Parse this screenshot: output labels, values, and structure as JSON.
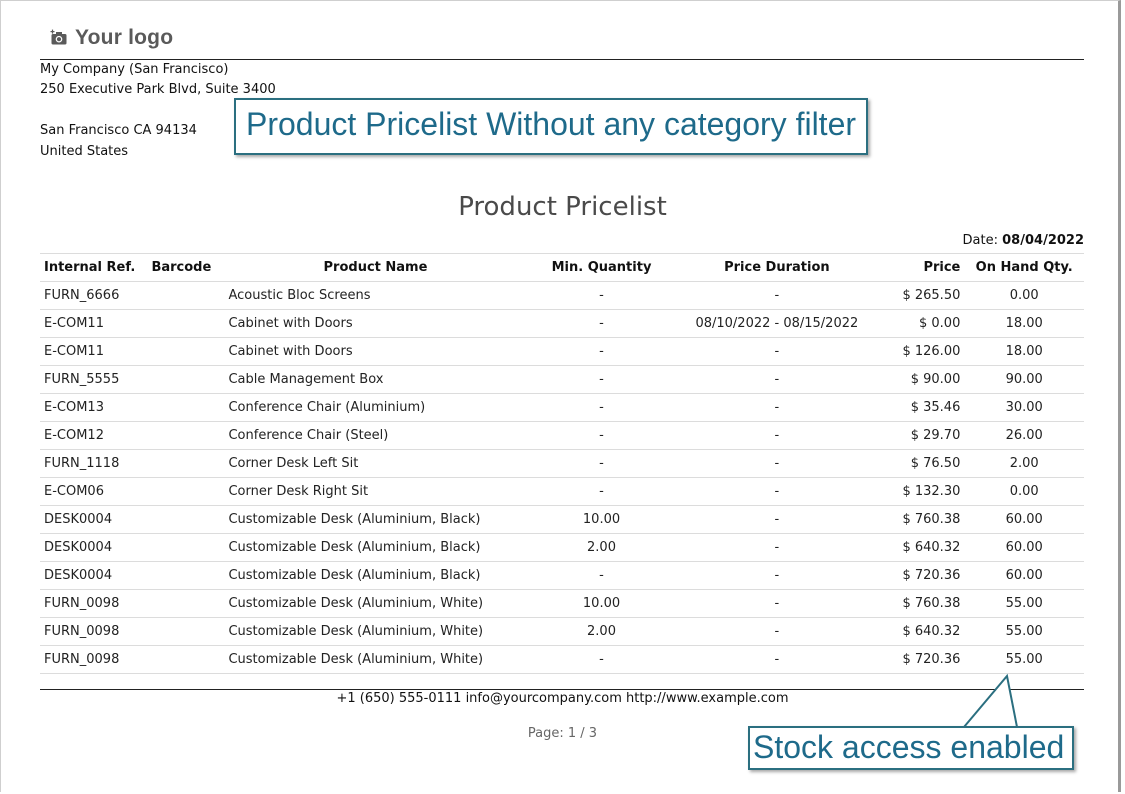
{
  "logo": {
    "text": "Your logo",
    "icon": "camera-icon"
  },
  "company": {
    "name": "My Company (San Francisco)",
    "street": "250 Executive Park Blvd, Suite 3400",
    "city": "San Francisco CA 94134",
    "country": "United States"
  },
  "annotations": {
    "title_note": "Product Pricelist Without any category filter",
    "stock_note": "Stock access enabled",
    "color": "#1e6a8a"
  },
  "report": {
    "title": "Product Pricelist",
    "date_label": "Date:",
    "date_value": "08/04/2022"
  },
  "table": {
    "headers": {
      "ref": "Internal Ref.",
      "barcode": "Barcode",
      "name": "Product Name",
      "min_qty": "Min. Quantity",
      "duration": "Price Duration",
      "price": "Price",
      "on_hand": "On Hand Qty."
    },
    "rows": [
      {
        "ref": "FURN_6666",
        "barcode": "",
        "name": "Acoustic Bloc Screens",
        "min_qty": "-",
        "duration": "-",
        "price": "$ 265.50",
        "on_hand": "0.00"
      },
      {
        "ref": "E-COM11",
        "barcode": "",
        "name": "Cabinet with Doors",
        "min_qty": "-",
        "duration": "08/10/2022 - 08/15/2022",
        "price": "$ 0.00",
        "on_hand": "18.00"
      },
      {
        "ref": "E-COM11",
        "barcode": "",
        "name": "Cabinet with Doors",
        "min_qty": "-",
        "duration": "-",
        "price": "$ 126.00",
        "on_hand": "18.00"
      },
      {
        "ref": "FURN_5555",
        "barcode": "",
        "name": "Cable Management Box",
        "min_qty": "-",
        "duration": "-",
        "price": "$ 90.00",
        "on_hand": "90.00"
      },
      {
        "ref": "E-COM13",
        "barcode": "",
        "name": "Conference Chair (Aluminium)",
        "min_qty": "-",
        "duration": "-",
        "price": "$ 35.46",
        "on_hand": "30.00"
      },
      {
        "ref": "E-COM12",
        "barcode": "",
        "name": "Conference Chair (Steel)",
        "min_qty": "-",
        "duration": "-",
        "price": "$ 29.70",
        "on_hand": "26.00"
      },
      {
        "ref": "FURN_1118",
        "barcode": "",
        "name": "Corner Desk Left Sit",
        "min_qty": "-",
        "duration": "-",
        "price": "$ 76.50",
        "on_hand": "2.00"
      },
      {
        "ref": "E-COM06",
        "barcode": "",
        "name": "Corner Desk Right Sit",
        "min_qty": "-",
        "duration": "-",
        "price": "$ 132.30",
        "on_hand": "0.00"
      },
      {
        "ref": "DESK0004",
        "barcode": "",
        "name": "Customizable Desk (Aluminium, Black)",
        "min_qty": "10.00",
        "duration": "-",
        "price": "$ 760.38",
        "on_hand": "60.00"
      },
      {
        "ref": "DESK0004",
        "barcode": "",
        "name": "Customizable Desk (Aluminium, Black)",
        "min_qty": "2.00",
        "duration": "-",
        "price": "$ 640.32",
        "on_hand": "60.00"
      },
      {
        "ref": "DESK0004",
        "barcode": "",
        "name": "Customizable Desk (Aluminium, Black)",
        "min_qty": "-",
        "duration": "-",
        "price": "$ 720.36",
        "on_hand": "60.00"
      },
      {
        "ref": "FURN_0098",
        "barcode": "",
        "name": "Customizable Desk (Aluminium, White)",
        "min_qty": "10.00",
        "duration": "-",
        "price": "$ 760.38",
        "on_hand": "55.00"
      },
      {
        "ref": "FURN_0098",
        "barcode": "",
        "name": "Customizable Desk (Aluminium, White)",
        "min_qty": "2.00",
        "duration": "-",
        "price": "$ 640.32",
        "on_hand": "55.00"
      },
      {
        "ref": "FURN_0098",
        "barcode": "",
        "name": "Customizable Desk (Aluminium, White)",
        "min_qty": "-",
        "duration": "-",
        "price": "$ 720.36",
        "on_hand": "55.00"
      }
    ]
  },
  "footer": {
    "contact": "+1 (650) 555-0111 info@yourcompany.com http://www.example.com",
    "page": "Page: 1 / 3"
  }
}
